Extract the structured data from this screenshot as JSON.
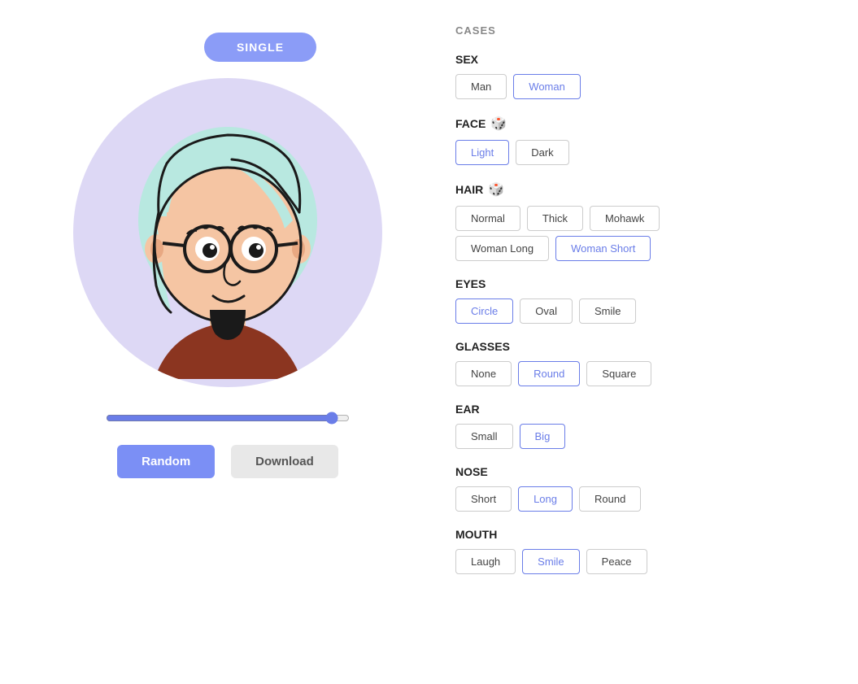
{
  "header": {
    "single_label": "SINGLE",
    "cases_label": "CASES"
  },
  "controls": {
    "random_label": "Random",
    "download_label": "Download"
  },
  "sections": [
    {
      "id": "sex",
      "title": "SEX",
      "has_dice": false,
      "options": [
        "Man",
        "Woman"
      ],
      "selected": "Woman",
      "multi_row": false
    },
    {
      "id": "face",
      "title": "FACE",
      "has_dice": true,
      "options": [
        "Light",
        "Dark"
      ],
      "selected": "Light",
      "multi_row": false
    },
    {
      "id": "hair",
      "title": "HAIR",
      "has_dice": true,
      "options": [
        "Normal",
        "Thick",
        "Mohawk",
        "Woman Long",
        "Woman Short"
      ],
      "selected": "Woman Short",
      "multi_row": true,
      "row1": [
        "Normal",
        "Thick",
        "Mohawk"
      ],
      "row2": [
        "Woman Long",
        "Woman Short"
      ]
    },
    {
      "id": "eyes",
      "title": "EYES",
      "has_dice": false,
      "options": [
        "Circle",
        "Oval",
        "Smile"
      ],
      "selected": "Circle",
      "multi_row": false
    },
    {
      "id": "glasses",
      "title": "GLASSES",
      "has_dice": false,
      "options": [
        "None",
        "Round",
        "Square"
      ],
      "selected": "Round",
      "multi_row": false
    },
    {
      "id": "ear",
      "title": "EAR",
      "has_dice": false,
      "options": [
        "Small",
        "Big"
      ],
      "selected": "Big",
      "multi_row": false
    },
    {
      "id": "nose",
      "title": "NOSE",
      "has_dice": false,
      "options": [
        "Short",
        "Long",
        "Round"
      ],
      "selected": "Long",
      "multi_row": false
    },
    {
      "id": "mouth",
      "title": "MOUTH",
      "has_dice": false,
      "options": [
        "Laugh",
        "Smile",
        "Peace"
      ],
      "selected": "Smile",
      "multi_row": false
    }
  ]
}
